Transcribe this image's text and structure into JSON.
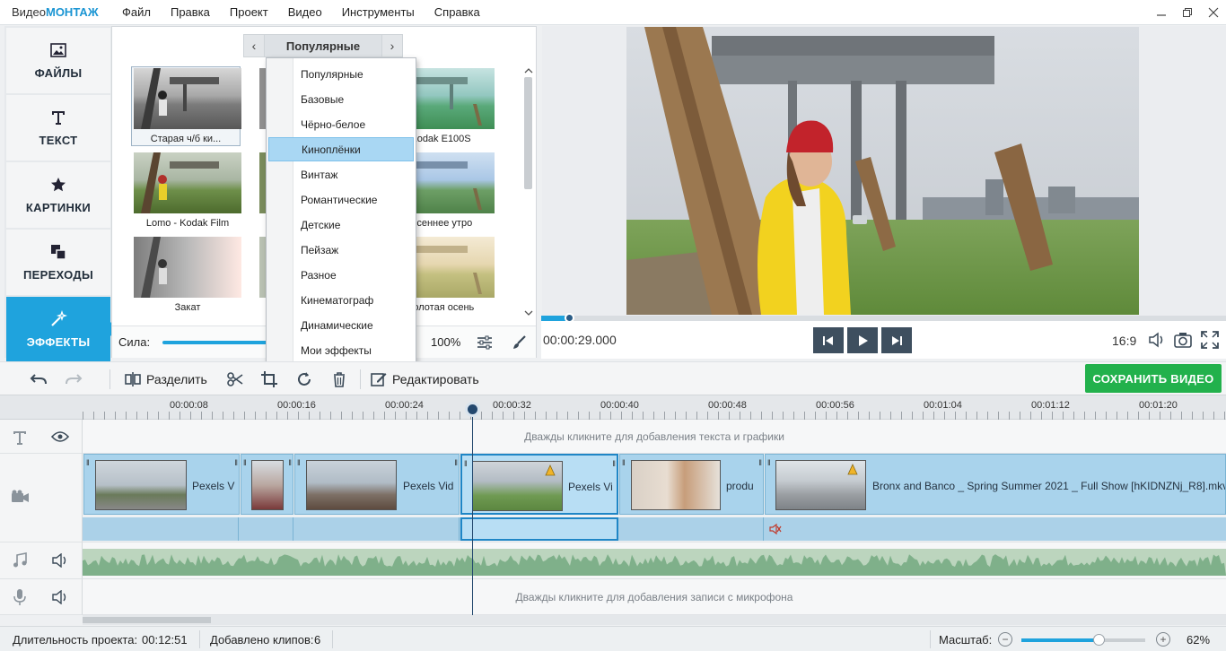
{
  "app": {
    "title_prefix": "Видео",
    "title_brand": "МОНТАЖ"
  },
  "menu": [
    "Файл",
    "Правка",
    "Проект",
    "Видео",
    "Инструменты",
    "Справка"
  ],
  "sidebar": {
    "items": [
      {
        "label": "ФАЙЛЫ",
        "icon": "image-icon"
      },
      {
        "label": "ТЕКСТ",
        "icon": "text-t-icon"
      },
      {
        "label": "КАРТИНКИ",
        "icon": "star-icon"
      },
      {
        "label": "ПЕРЕХОДЫ",
        "icon": "overlap-squares-icon"
      },
      {
        "label": "ЭФФЕКТЫ",
        "icon": "magic-wand-icon"
      }
    ],
    "active_index": 4
  },
  "effects": {
    "category": "Популярные",
    "thumbnails": [
      {
        "caption": "Старая ч/б ки..."
      },
      {
        "caption": "Kodak E100S"
      },
      {
        "caption": "Lomo - Kodak Film"
      },
      {
        "caption": "Осеннее утро"
      },
      {
        "caption": "Закат"
      },
      {
        "caption": "Золотая осень"
      }
    ],
    "strength_label": "Сила:",
    "strength_value": "100%",
    "strength_level": 1.0
  },
  "dropdown": {
    "items": [
      "Популярные",
      "Базовые",
      "Чёрно-белое",
      "Киноплёнки",
      "Винтаж",
      "Романтические",
      "Детские",
      "Пейзаж",
      "Разное",
      "Кинематограф",
      "Динамические",
      "Мои эффекты"
    ],
    "highlighted_index": 3
  },
  "player": {
    "time": "00:00:29.000",
    "aspect": "16:9",
    "progress": 0.04
  },
  "toolbar": {
    "split_label": "Разделить",
    "edit_label": "Редактировать",
    "save_label": "СОХРАНИТЬ ВИДЕО"
  },
  "ruler": [
    "00:00:08",
    "00:00:16",
    "00:00:24",
    "00:00:32",
    "00:00:40",
    "00:00:48",
    "00:00:56",
    "00:01:04",
    "00:01:12",
    "00:01:20"
  ],
  "timeline": {
    "text_hint": "Дважды кликните для добавления текста и графики",
    "mic_hint": "Дважды кликните для добавления записи с микрофона",
    "clips": [
      {
        "name": "Pexels V"
      },
      {
        "name": ""
      },
      {
        "name": "Pexels Vid"
      },
      {
        "name": "Pexels Vi"
      },
      {
        "name": "produ"
      },
      {
        "name": "Bronx and Banco _ Spring Summer 2021 _ Full Show [hKIDNZNj_R8].mkv"
      }
    ]
  },
  "status": {
    "duration_label": "Длительность проекта:",
    "duration_value": "00:12:51",
    "clips_label": "Добавлено клипов:",
    "clips_value": "6",
    "zoom_label": "Масштаб:",
    "zoom_value": "62%",
    "zoom_level": 0.62
  },
  "colors": {
    "accent": "#1fa3dd",
    "save": "#22b14c",
    "clip": "#a9d3ec",
    "playhead": "#23486e"
  }
}
